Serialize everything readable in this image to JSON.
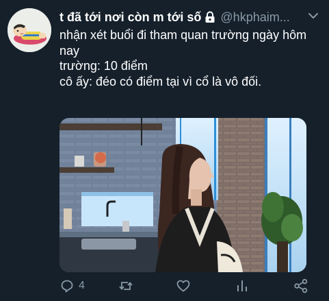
{
  "tweet": {
    "display_name": "t đã tới nơi còn m tới số",
    "handle": "@hkphaim...",
    "text_lines": [
      "nhận xét buổi đi tham quan trường ngày hôm nay",
      "trường: 10 điểm",
      "cô ấy: đéo có điểm tại vì cổ là vô đối."
    ],
    "replies_count": "4"
  },
  "icons": {
    "lock": "lock-icon",
    "more": "chevron-down-icon",
    "reply": "reply-icon",
    "retweet": "retweet-icon",
    "like": "heart-icon",
    "analytics": "analytics-icon",
    "share": "share-icon"
  },
  "colors": {
    "background": "#15202b",
    "primary_text": "#ffffff",
    "secondary_text": "#8899a6"
  }
}
